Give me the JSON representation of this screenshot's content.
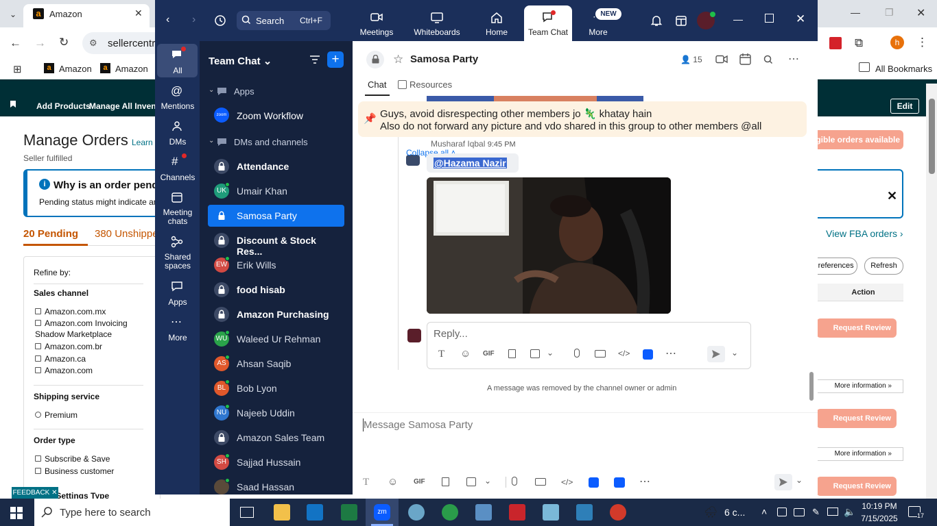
{
  "browser": {
    "tab_title": "Amazon",
    "url": "sellercentra",
    "bookmarks": [
      "Amazon",
      "Amazon"
    ],
    "all_bookmarks": "All Bookmarks",
    "profile_initial": "h"
  },
  "amazon": {
    "nav": [
      "Add Products",
      "Manage All Inventor"
    ],
    "edit": "Edit",
    "title": "Manage Orders",
    "learn": "Learn n",
    "subtitle": "Seller fulfilled",
    "alert_title": "Why is an order pendi",
    "alert_text": "Pending status might indicate an",
    "pending_tab": "20 Pending",
    "unshipped_tab": "380 Unshippe",
    "refine": "Refine by:",
    "sales_channel": "Sales channel",
    "channels": [
      "Amazon.com.mx",
      "Amazon.com Invoicing",
      "Shadow Marketplace",
      "Amazon.com.br",
      "Amazon.ca",
      "Amazon.com"
    ],
    "shipping_service": "Shipping service",
    "premium": "Premium",
    "order_type": "Order type",
    "order_types": [
      "Subscribe & Save",
      "Business customer"
    ],
    "shipping_settings": "ing Settings Type",
    "feedback": "FEEDBACK",
    "eligible": "igible orders available",
    "fba": "View FBA orders",
    "preferences": "Preferences",
    "refresh": "Refresh",
    "action": "Action",
    "request_review": "Request Review",
    "more_info": "More information"
  },
  "zoom": {
    "search": "Search",
    "search_shortcut": "Ctrl+F",
    "top_nav": [
      "Meetings",
      "Whiteboards",
      "Home",
      "Team Chat",
      "More"
    ],
    "new_badge": "NEW",
    "rail": [
      "All",
      "Mentions",
      "DMs",
      "Channels",
      "Meeting chats",
      "Shared spaces",
      "Apps",
      "More"
    ],
    "sidebar_title": "Team Chat",
    "apps_section": "Apps",
    "dms_section": "DMs and channels",
    "zoom_workflow": "Zoom Workflow",
    "zoom_logo": "zoom",
    "chats": [
      {
        "name": "Attendance",
        "type": "lock",
        "bold": true
      },
      {
        "name": "Umair Khan",
        "type": "avatar",
        "initials": "UK",
        "color": "#1f9c7a"
      },
      {
        "name": "Samosa Party",
        "type": "lock",
        "selected": true
      },
      {
        "name": "Discount & Stock Res...",
        "type": "lock",
        "bold": true
      },
      {
        "name": "Erik Wills",
        "type": "avatar",
        "initials": "EW",
        "color": "#d24a43"
      },
      {
        "name": "food hisab",
        "type": "lock",
        "bold": true
      },
      {
        "name": "Amazon Purchasing",
        "type": "lock",
        "bold": true
      },
      {
        "name": "Waleed Ur Rehman",
        "type": "avatar",
        "initials": "WU",
        "color": "#2aa34a"
      },
      {
        "name": "Ahsan Saqib",
        "type": "avatar",
        "initials": "AS",
        "color": "#e0582b"
      },
      {
        "name": "Bob Lyon",
        "type": "avatar",
        "initials": "BL",
        "color": "#e0582b"
      },
      {
        "name": "Najeeb Uddin",
        "type": "avatar",
        "initials": "NU",
        "color": "#2f77d0"
      },
      {
        "name": "Amazon Sales Team",
        "type": "lock"
      },
      {
        "name": "Sajjad Hussain",
        "type": "avatar",
        "initials": "SH",
        "color": "#d24a43"
      },
      {
        "name": "Saad Hassan",
        "type": "avatar",
        "initials": "",
        "color": "#5a4a3a"
      }
    ],
    "channel_title": "Samosa Party",
    "member_count": "15",
    "tab_chat": "Chat",
    "tab_resources": "Resources",
    "pinned_line1": "Guys, avoid disrespecting other members jo 🦎 khatay hain",
    "pinned_line2": "Also do not forward any picture and vdo shared in this group to other members @all",
    "sender": "Musharaf Iqbal",
    "sender_time": "9:45 PM",
    "collapse_all": "Collapse all",
    "mention": "@Hazama Nazir",
    "reply_placeholder": "Reply...",
    "removed_notice": "A message was removed by the channel owner or admin",
    "compose_placeholder": "Message Samosa Party"
  },
  "taskbar": {
    "search": "Type here to search",
    "weather": "6 c...",
    "time": "10:19 PM",
    "date": "7/15/2025",
    "notif_count": "17"
  }
}
